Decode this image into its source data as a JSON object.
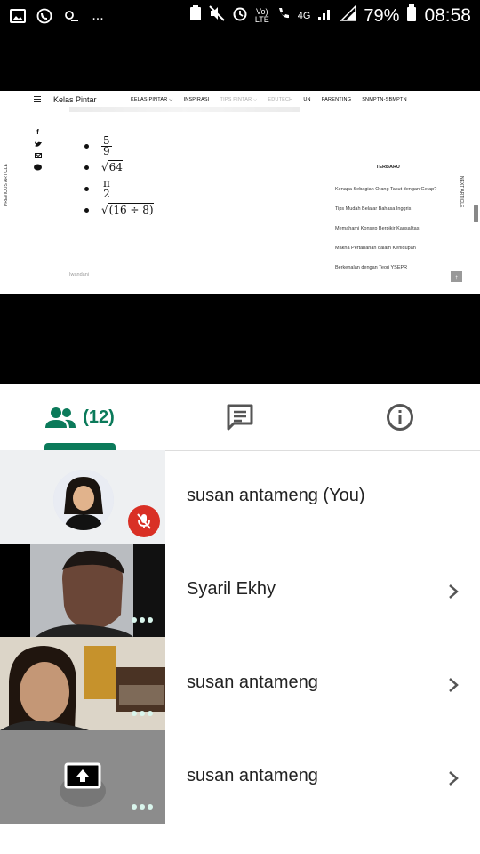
{
  "status_bar": {
    "battery": "79%",
    "time": "08:58",
    "network": "4G",
    "volte_line1": "Vo)",
    "volte_line2": "LTE",
    "more": "..."
  },
  "shared_screen": {
    "site_title": "Kelas Pintar",
    "nav": [
      "KELAS PINTAR ⌵",
      "INSPIRASI",
      "TIPS PINTAR ⌵",
      "EDUTECH",
      "UN",
      "PARENTING",
      "SNMPTN-SBMPTN"
    ],
    "prev_article": "PREVIOUS ARTICLE",
    "next_article": "NEXT ARTICLE",
    "math": {
      "frac1_num": "5",
      "frac1_den": "9",
      "sqrt_radicand": "64",
      "frac2_num": "π",
      "frac2_den": "2",
      "sqrt2_radicand": "(16 ÷ 8)"
    },
    "trending_title": "TERBARU",
    "trending": [
      "Kenapa Sebagian Orang Takut dengan Gelap?",
      "Tips Mudah Belajar Bahasa Inggris",
      "Memahami Konsep Berpikir Kausalitas",
      "Makna Pertahanan dalam Kehidupan",
      "Berkenalan dengan Teori YSEPR"
    ],
    "footer_word": "Iwandani"
  },
  "tabs": {
    "people_count": "(12)"
  },
  "participants": [
    {
      "name": "susan antameng (You)",
      "muted": true
    },
    {
      "name": "Syaril Ekhy"
    },
    {
      "name": "susan antameng"
    },
    {
      "name": "susan antameng"
    }
  ],
  "colors": {
    "accent": "#0b7a5a",
    "mute_red": "#d93025"
  }
}
